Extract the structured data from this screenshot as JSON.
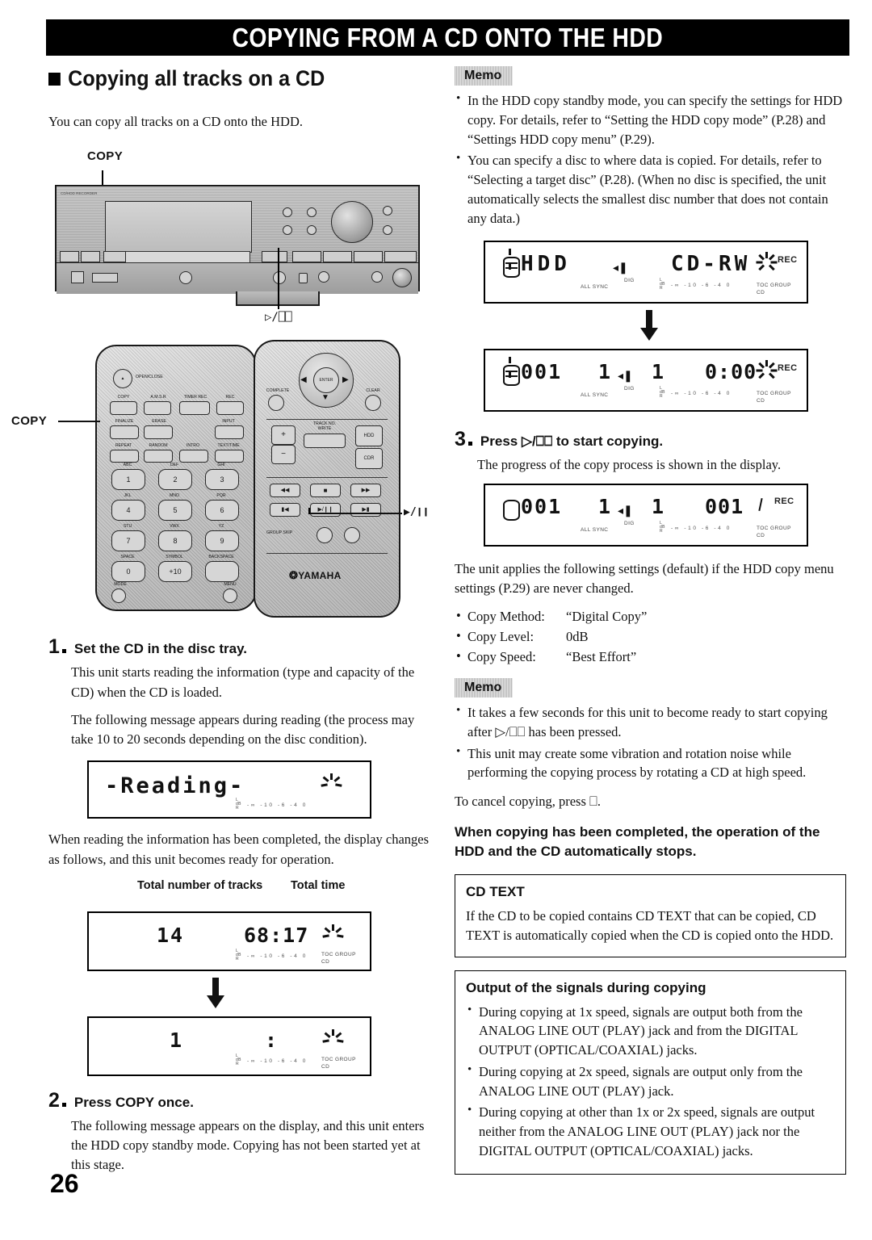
{
  "page": {
    "number": "26",
    "banner_title": "COPYING FROM A CD ONTO THE HDD"
  },
  "left": {
    "section_heading": "Copying all tracks on a CD",
    "intro": "You can copy all tracks on a CD onto the HDD.",
    "unit_callout_top": "COPY",
    "unit_callout_bottom": "▷/⎕⎕",
    "remote_callout_copy": "COPY",
    "remote_callout_play": "▶/❙❙",
    "remote_left": {
      "open_close": "OPEN/CLOSE",
      "row1": [
        "COPY",
        "A.M.S.R",
        "TIMER REC",
        "REC"
      ],
      "row2": [
        "FINALIZE",
        "ERASE",
        "INPUT"
      ],
      "row3": [
        "REPEAT",
        "RANDOM",
        "INTRO",
        "TEXT/TIME"
      ],
      "keypad": [
        {
          "letters": "ABC",
          "digit": "1"
        },
        {
          "letters": "DEF",
          "digit": "2"
        },
        {
          "letters": "GHI",
          "digit": "3"
        },
        {
          "letters": "JKL",
          "digit": "4"
        },
        {
          "letters": "MNO",
          "digit": "5"
        },
        {
          "letters": "PQR",
          "digit": "6"
        },
        {
          "letters": "STU",
          "digit": "7"
        },
        {
          "letters": "VWX",
          "digit": "8"
        },
        {
          "letters": "YZ",
          "digit": "9"
        },
        {
          "letters": "SPACE",
          "digit": "0"
        },
        {
          "letters": "SYMBOL",
          "digit": "+10"
        },
        {
          "letters": "BACKSPACE",
          "digit": ""
        }
      ],
      "bottom": [
        "MODE",
        "MENU"
      ]
    },
    "remote_right": {
      "enter": "ENTER",
      "complete": "COMPLETE",
      "clear": "CLEAR",
      "plus": "+",
      "minus": "−",
      "track_no_write": "TRACK NO.\nWRITE",
      "hdd": "HDD",
      "cdr": "CDR",
      "group_skip": "GROUP SKIP",
      "brand": "YAMAHA"
    },
    "steps": [
      {
        "num": "1",
        "title": "Set the CD in the disc tray.",
        "paras": [
          "This unit starts reading the information (type and capacity of the CD) when the CD is loaded.",
          "The following message appears during reading (the process may take 10 to 20 seconds depending on the disc condition)."
        ]
      },
      {
        "num": "2",
        "title": "Press COPY once.",
        "paras": [
          "The following message appears on the display, and this unit enters the HDD copy standby mode. Copying has not been started yet at this stage."
        ]
      }
    ],
    "after_reading_para": "When reading the information has been completed, the display changes as follows, and this unit becomes ready for operation.",
    "lcd_reading": {
      "main": "-Reading-",
      "scale": "-∞ -10 -6 -4 0",
      "db": "L\ndB\nR"
    },
    "caption_tracks": "Total number of tracks",
    "caption_time": "Total time",
    "lcd_totals": {
      "tracks": "14",
      "time": "68:17",
      "scale": "-∞ -10 -6 -4 0",
      "toc_group": "TOC GROUP",
      "cd": "CD"
    },
    "lcd_track1": {
      "track": "1",
      "time": ":",
      "scale": "-∞ -10 -6 -4 0",
      "toc_group": "TOC GROUP",
      "cd": "CD"
    }
  },
  "right": {
    "memo1": {
      "tag": "Memo",
      "items": [
        "In the HDD copy standby mode, you can specify the settings for HDD copy. For details, refer to “Setting the HDD copy mode” (P.28) and “Settings HDD copy menu” (P.29).",
        "You can specify a disc to where data is copied. For details, refer to “Selecting a target disc” (P.28). (When no disc is specified, the unit automatically selects the smallest disc number that does not contain any data.)"
      ]
    },
    "lcd_standby1": {
      "source": "HDD",
      "target": "CD-RW",
      "rec": "REC",
      "all_sync": "ALL SYNC",
      "dig": "DIG",
      "scale": "-∞ -10 -6 -4 0",
      "toc_group": "TOC GROUP",
      "cd": "CD"
    },
    "lcd_standby2": {
      "disc": "001",
      "track_from": "1",
      "track_to": "1",
      "time": "0:00",
      "rec": "REC",
      "all_sync": "ALL SYNC",
      "dig": "DIG",
      "scale": "-∞ -10 -6 -4 0",
      "toc_group": "TOC GROUP",
      "cd": "CD"
    },
    "step3": {
      "num": "3",
      "title": "Press ▷/⎕⎕ to start copying.",
      "para": "The progress of the copy process is shown in the display."
    },
    "lcd_progress": {
      "disc": "001",
      "track_from": "1",
      "track_to": "1",
      "time": "001",
      "rec": "REC",
      "all_sync": "ALL SYNC",
      "dig": "DIG",
      "scale": "-∞ -10 -6 -4 0",
      "toc_group": "TOC GROUP",
      "cd": "CD"
    },
    "defaults_intro": "The unit applies the following settings (default) if the HDD copy menu settings (P.29) are never changed.",
    "defaults": [
      {
        "key": "Copy Method:",
        "value": "“Digital Copy”"
      },
      {
        "key": "Copy Level:",
        "value": "0dB"
      },
      {
        "key": "Copy Speed:",
        "value": "“Best Effort”"
      }
    ],
    "memo2": {
      "tag": "Memo",
      "items": [
        "It takes a few seconds for this unit to become ready to start copying after ▷/⎕⎕ has been pressed.",
        "This unit may create some vibration and rotation noise while performing the copying process by rotating a CD at high speed."
      ]
    },
    "cancel_para": "To cancel copying, press ⎕.",
    "completed_note": "When copying has been completed, the operation of the HDD and the CD automatically stops.",
    "cd_text_box": {
      "heading": "CD TEXT",
      "body": "If the CD to be copied contains CD TEXT that can be copied, CD TEXT is automatically copied when the CD is copied onto the HDD."
    },
    "output_box": {
      "heading": "Output of the signals during copying",
      "items": [
        "During copying at 1x speed, signals are output both from the ANALOG LINE OUT (PLAY) jack and from the DIGITAL OUTPUT (OPTICAL/COAXIAL) jacks.",
        "During copying at 2x speed, signals are output only from the ANALOG LINE OUT (PLAY) jack.",
        "During copying at other than 1x or 2x speed, signals are output neither from the ANALOG LINE OUT (PLAY) jack nor the DIGITAL OUTPUT (OPTICAL/COAXIAL) jacks."
      ]
    }
  }
}
